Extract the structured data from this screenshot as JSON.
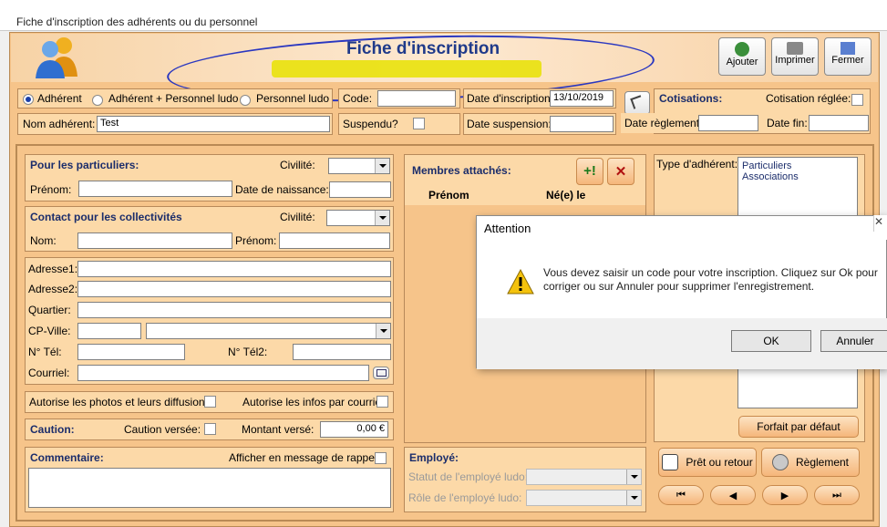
{
  "window_title": "Fiche d'inscription des adhérents ou du personnel",
  "header": {
    "title": "Fiche d'inscription",
    "buttons": {
      "add": "Ajouter",
      "print": "Imprimer",
      "close": "Fermer"
    }
  },
  "type_radio": {
    "opt1": "Adhérent",
    "opt2": "Adhérent + Personnel ludo",
    "opt3": "Personnel ludo",
    "selected": "Adhérent"
  },
  "top": {
    "code_label": "Code:",
    "code_value": "",
    "date_inscription_label": "Date d'inscription:",
    "date_inscription_value": "13/10/2019",
    "nom_label": "Nom adhérent:",
    "nom_value": "Test",
    "suspendu_label": "Suspendu?",
    "date_suspension_label": "Date  suspension:"
  },
  "cotisations": {
    "title": "Cotisations:",
    "reglee_label": "Cotisation réglée:",
    "date_reglement_label": "Date règlement:",
    "date_fin_label": "Date fin:"
  },
  "particuliers": {
    "title": "Pour les particuliers:",
    "civilite_label": "Civilité:",
    "prenom_label": "Prénom:",
    "naissance_label": "Date de naissance:"
  },
  "collectivites": {
    "title": "Contact pour les collectivités",
    "civilite_label": "Civilité:",
    "nom_label": "Nom:",
    "prenom_label": "Prénom:"
  },
  "adresse": {
    "adresse1": "Adresse1:",
    "adresse2": "Adresse2:",
    "quartier": "Quartier:",
    "cp_ville": "CP-Ville:",
    "tel": "N° Tél:",
    "tel2": "N° Tél2:",
    "courriel": "Courriel:"
  },
  "autorisations": {
    "photos": "Autorise les photos et leurs diffusions:",
    "infos": "Autorise les infos par courriel:"
  },
  "caution": {
    "title": "Caution:",
    "versee_label": "Caution versée:",
    "montant_label": "Montant versé:",
    "montant_value": "0,00 €"
  },
  "commentaire": {
    "title": "Commentaire:",
    "rappel_label": "Afficher en message de rappel"
  },
  "membres": {
    "title": "Membres attachés:",
    "col_prenom": "Prénom",
    "col_ne": "Né(e) le"
  },
  "employe": {
    "title": "Employé:",
    "statut_label": "Statut de l'employé ludo:",
    "role_label": "Rôle de l'employé ludo:"
  },
  "type_adherent": {
    "label": "Type d'adhérent:",
    "items": [
      "Particuliers",
      "Associations"
    ],
    "forfait_button": "Forfait par défaut"
  },
  "actions": {
    "pret_button": "Prêt ou retour",
    "reglement_button": "Règlement"
  },
  "dialog": {
    "title": "Attention",
    "message_line1": "Vous devez saisir un code pour votre inscription. Cliquez sur Ok pour",
    "message_line2": "corriger ou sur Annuler pour supprimer l'enregistrement.",
    "ok": "OK",
    "cancel": "Annuler"
  }
}
